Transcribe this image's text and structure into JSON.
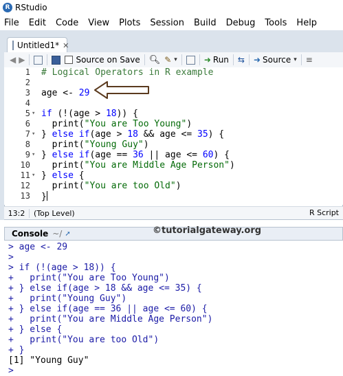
{
  "app": {
    "title": "RStudio"
  },
  "menu": [
    "File",
    "Edit",
    "Code",
    "View",
    "Plots",
    "Session",
    "Build",
    "Debug",
    "Tools",
    "Help"
  ],
  "editor": {
    "tab_title": "Untitled1*",
    "toolbar": {
      "source_on_save": "Source on Save",
      "run": "Run",
      "source": "Source"
    },
    "lines": [
      {
        "n": "1",
        "fold": "",
        "html": "<span class='cmt'># Logical Operators in R example</span>"
      },
      {
        "n": "2",
        "fold": "",
        "html": ""
      },
      {
        "n": "3",
        "fold": "",
        "html": "age &lt;- <span class='num'>29</span>"
      },
      {
        "n": "4",
        "fold": "",
        "html": ""
      },
      {
        "n": "5",
        "fold": "▾",
        "html": "<span class='kw'>if</span> (!(age &gt; <span class='num'>18</span>)) {"
      },
      {
        "n": "6",
        "fold": "",
        "html": "  print(<span class='str'>\"You are Too Young\"</span>)"
      },
      {
        "n": "7",
        "fold": "▾",
        "html": "} <span class='kw'>else if</span>(age &gt; <span class='num'>18</span> &amp;&amp; age &lt;= <span class='num'>35</span>) {"
      },
      {
        "n": "8",
        "fold": "",
        "html": "  print(<span class='str'>\"Young Guy\"</span>)"
      },
      {
        "n": "9",
        "fold": "▾",
        "html": "} <span class='kw'>else if</span>(age == <span class='num'>36</span> || age &lt;= <span class='num'>60</span>) {"
      },
      {
        "n": "10",
        "fold": "",
        "html": "  print(<span class='str'>\"You are Middle Age Person\"</span>)"
      },
      {
        "n": "11",
        "fold": "▾",
        "html": "} <span class='kw'>else</span> {"
      },
      {
        "n": "12",
        "fold": "",
        "html": "  print(<span class='str'>\"You are too Old\"</span>)"
      },
      {
        "n": "13",
        "fold": "",
        "html": "}<span class='cursor'></span>"
      }
    ],
    "status": {
      "position": "13:2",
      "scope": "(Top Level)",
      "filetype": "R Script"
    }
  },
  "console": {
    "label": "Console",
    "path": "~/",
    "watermark": "©tutorialgateway.org",
    "lines": [
      {
        "p": "> ",
        "t": "age <- 29",
        "c": "cin"
      },
      {
        "p": "> ",
        "t": "",
        "c": "cin"
      },
      {
        "p": "> ",
        "t": "if (!(age > 18)) {",
        "c": "cin"
      },
      {
        "p": "+ ",
        "t": "  print(\"You are Too Young\")",
        "c": "cin"
      },
      {
        "p": "+ ",
        "t": "} else if(age > 18 && age <= 35) {",
        "c": "cin"
      },
      {
        "p": "+ ",
        "t": "  print(\"Young Guy\")",
        "c": "cin"
      },
      {
        "p": "+ ",
        "t": "} else if(age == 36 || age <= 60) {",
        "c": "cin"
      },
      {
        "p": "+ ",
        "t": "  print(\"You are Middle Age Person\")",
        "c": "cin"
      },
      {
        "p": "+ ",
        "t": "} else {",
        "c": "cin"
      },
      {
        "p": "+ ",
        "t": "  print(\"You are too Old\")",
        "c": "cin"
      },
      {
        "p": "+ ",
        "t": "}",
        "c": "cin"
      },
      {
        "p": "",
        "t": "[1] \"Young Guy\"",
        "c": "out"
      },
      {
        "p": "> ",
        "t": "",
        "c": "cin"
      }
    ]
  }
}
